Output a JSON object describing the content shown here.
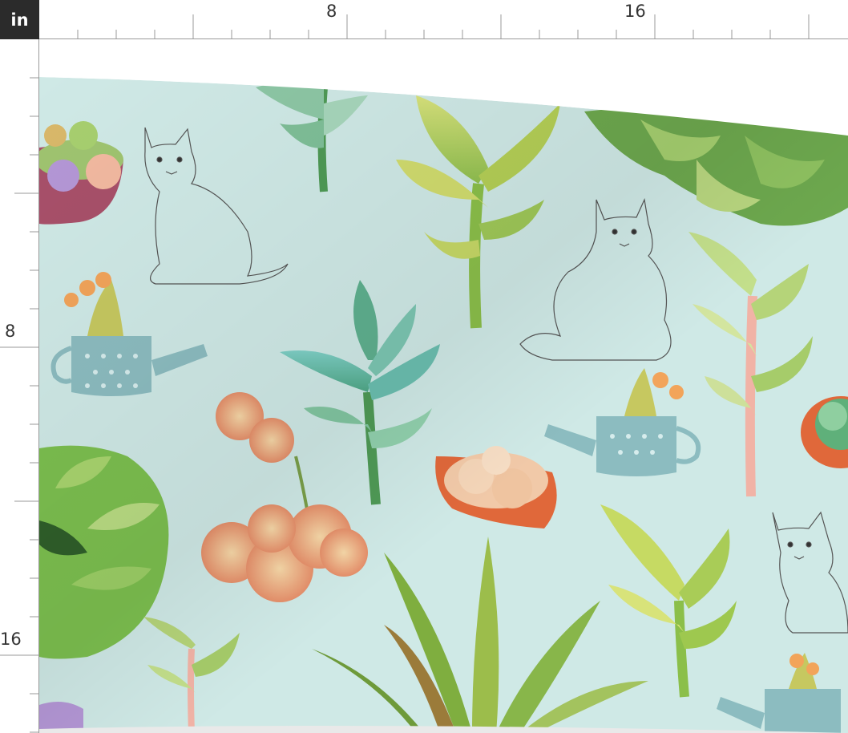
{
  "ruler": {
    "unit_label": "in",
    "top_labels": [
      "8",
      "16"
    ],
    "left_labels": [
      "8",
      "16"
    ]
  },
  "design": {
    "background_color": "#cfe9e6",
    "motifs": [
      "succulent-bowl-icon",
      "cat-sketch-icon",
      "watering-can-icon",
      "jade-plant-icon",
      "echeveria-icon",
      "aloe-icon",
      "terracotta-pot-icon",
      "rosette-icon"
    ]
  }
}
